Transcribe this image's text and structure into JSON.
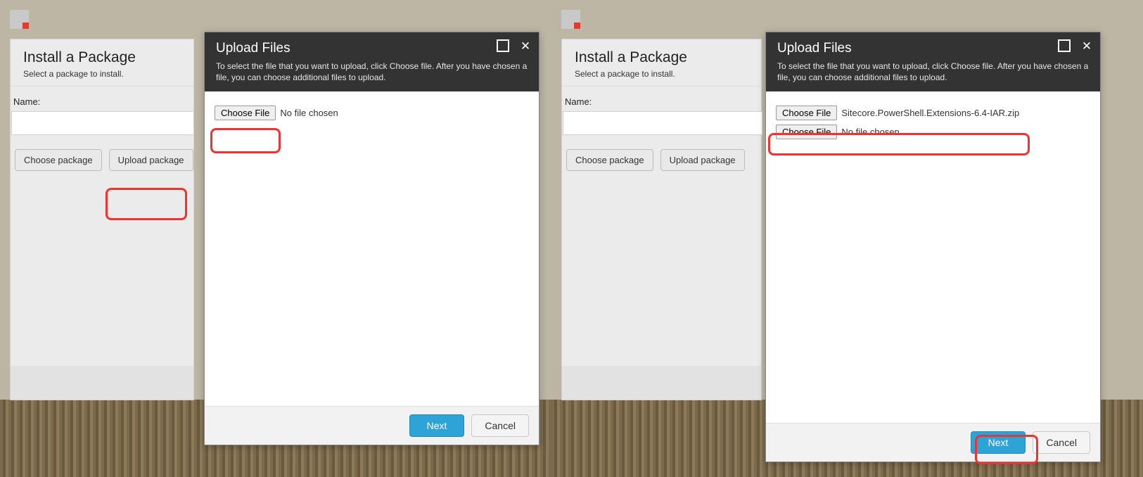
{
  "left": {
    "panel": {
      "title": "Install a Package",
      "subtitle": "Select a package to install.",
      "name_label": "Name:",
      "name_value": "",
      "choose_package": "Choose package",
      "upload_package": "Upload package"
    },
    "dialog": {
      "title": "Upload Files",
      "subtitle": "To select the file that you want to upload, click Choose file. After you have chosen a file, you can choose additional files to upload.",
      "choose_file": "Choose File",
      "file_text": "No file chosen",
      "next": "Next",
      "cancel": "Cancel"
    }
  },
  "right": {
    "panel": {
      "title": "Install a Package",
      "subtitle": "Select a package to install.",
      "name_label": "Name:",
      "name_value": "",
      "choose_package": "Choose package",
      "upload_package": "Upload package"
    },
    "dialog": {
      "title": "Upload Files",
      "subtitle": "To select the file that you want to upload, click Choose file. After you have chosen a file, you can choose additional files to upload.",
      "rows": [
        {
          "choose_file": "Choose File",
          "file_text": "Sitecore.PowerShell.Extensions-6.4-IAR.zip"
        },
        {
          "choose_file": "Choose File",
          "file_text": "No file chosen"
        }
      ],
      "next": "Next",
      "cancel": "Cancel"
    }
  }
}
